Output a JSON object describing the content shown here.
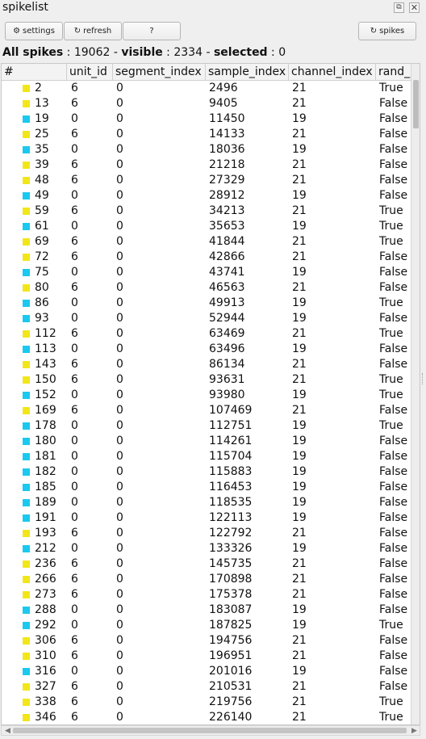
{
  "window": {
    "title": "spikelist",
    "float_icon": "⧉",
    "close_icon": "✕"
  },
  "toolbar": {
    "settings_label": "settings",
    "settings_icon": "⚙",
    "refresh_label": "refresh",
    "refresh_icon": "↻",
    "help_label": "?",
    "spikes_label": "spikes",
    "spikes_icon": "↻"
  },
  "summary": {
    "all_label": "All spikes",
    "all_value": "19062",
    "visible_label": "visible",
    "visible_value": "2334",
    "selected_label": "selected",
    "selected_value": "0",
    "sep": " - ",
    "colon": " : "
  },
  "colors": {
    "unit_6": "#f2e619",
    "unit_0": "#1ac9ef"
  },
  "table": {
    "columns": [
      "#",
      "unit_id",
      "segment_index",
      "sample_index",
      "channel_index",
      "rand_"
    ],
    "rows": [
      [
        "2",
        "6",
        "0",
        "2496",
        "21",
        "True"
      ],
      [
        "13",
        "6",
        "0",
        "9405",
        "21",
        "False"
      ],
      [
        "19",
        "0",
        "0",
        "11450",
        "19",
        "False"
      ],
      [
        "25",
        "6",
        "0",
        "14133",
        "21",
        "False"
      ],
      [
        "35",
        "0",
        "0",
        "18036",
        "19",
        "False"
      ],
      [
        "39",
        "6",
        "0",
        "21218",
        "21",
        "False"
      ],
      [
        "48",
        "6",
        "0",
        "27329",
        "21",
        "False"
      ],
      [
        "49",
        "0",
        "0",
        "28912",
        "19",
        "False"
      ],
      [
        "59",
        "6",
        "0",
        "34213",
        "21",
        "True"
      ],
      [
        "61",
        "0",
        "0",
        "35653",
        "19",
        "True"
      ],
      [
        "69",
        "6",
        "0",
        "41844",
        "21",
        "True"
      ],
      [
        "72",
        "6",
        "0",
        "42866",
        "21",
        "False"
      ],
      [
        "75",
        "0",
        "0",
        "43741",
        "19",
        "False"
      ],
      [
        "80",
        "6",
        "0",
        "46563",
        "21",
        "False"
      ],
      [
        "86",
        "0",
        "0",
        "49913",
        "19",
        "True"
      ],
      [
        "93",
        "0",
        "0",
        "52944",
        "19",
        "False"
      ],
      [
        "112",
        "6",
        "0",
        "63469",
        "21",
        "True"
      ],
      [
        "113",
        "0",
        "0",
        "63496",
        "19",
        "False"
      ],
      [
        "143",
        "6",
        "0",
        "86134",
        "21",
        "False"
      ],
      [
        "150",
        "6",
        "0",
        "93631",
        "21",
        "True"
      ],
      [
        "152",
        "0",
        "0",
        "93980",
        "19",
        "True"
      ],
      [
        "169",
        "6",
        "0",
        "107469",
        "21",
        "False"
      ],
      [
        "178",
        "0",
        "0",
        "112751",
        "19",
        "True"
      ],
      [
        "180",
        "0",
        "0",
        "114261",
        "19",
        "False"
      ],
      [
        "181",
        "0",
        "0",
        "115704",
        "19",
        "False"
      ],
      [
        "182",
        "0",
        "0",
        "115883",
        "19",
        "False"
      ],
      [
        "185",
        "0",
        "0",
        "116453",
        "19",
        "False"
      ],
      [
        "189",
        "0",
        "0",
        "118535",
        "19",
        "False"
      ],
      [
        "191",
        "0",
        "0",
        "122113",
        "19",
        "False"
      ],
      [
        "193",
        "6",
        "0",
        "122792",
        "21",
        "False"
      ],
      [
        "212",
        "0",
        "0",
        "133326",
        "19",
        "False"
      ],
      [
        "236",
        "6",
        "0",
        "145735",
        "21",
        "False"
      ],
      [
        "266",
        "6",
        "0",
        "170898",
        "21",
        "False"
      ],
      [
        "273",
        "6",
        "0",
        "175378",
        "21",
        "False"
      ],
      [
        "288",
        "0",
        "0",
        "183087",
        "19",
        "False"
      ],
      [
        "292",
        "0",
        "0",
        "187825",
        "19",
        "True"
      ],
      [
        "306",
        "6",
        "0",
        "194756",
        "21",
        "False"
      ],
      [
        "310",
        "6",
        "0",
        "196951",
        "21",
        "False"
      ],
      [
        "316",
        "0",
        "0",
        "201016",
        "19",
        "False"
      ],
      [
        "327",
        "6",
        "0",
        "210531",
        "21",
        "False"
      ],
      [
        "338",
        "6",
        "0",
        "219756",
        "21",
        "True"
      ],
      [
        "346",
        "6",
        "0",
        "226140",
        "21",
        "True"
      ]
    ]
  }
}
